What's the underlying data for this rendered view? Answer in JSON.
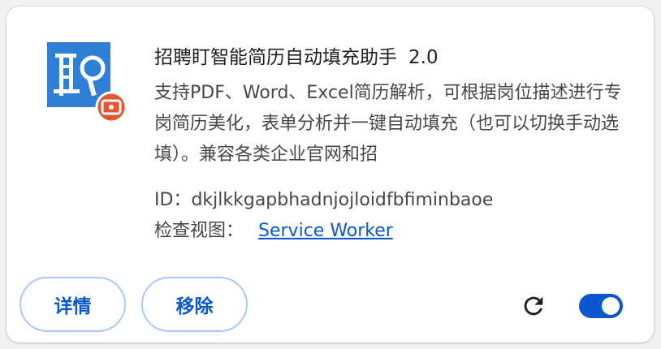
{
  "extension": {
    "name": "招聘盯智能简历自动填充助手",
    "version": "2.0",
    "description": "支持PDF、Word、Excel简历解析，可根据岗位描述进行专岗简历美化，表单分析并一键自动填充（也可以切换手动选填）。兼容各类企业官网和招",
    "id_label": "ID：",
    "id_value": "dkjlkkgapbhadnjojloidfbfiminbaoe",
    "inspect_label": "检查视图：",
    "inspect_link": "Service Worker",
    "icon": "zhi-logo-icon",
    "badge_icon": "camera-badge-icon"
  },
  "actions": {
    "details_label": "详情",
    "remove_label": "移除",
    "reload_icon": "reload-icon",
    "toggle_enabled": true
  },
  "colors": {
    "accent": "#0b57d0",
    "button_border": "#a8c7fa",
    "logo_blue": "#2f7fd6",
    "badge_red": "#e4572e"
  }
}
